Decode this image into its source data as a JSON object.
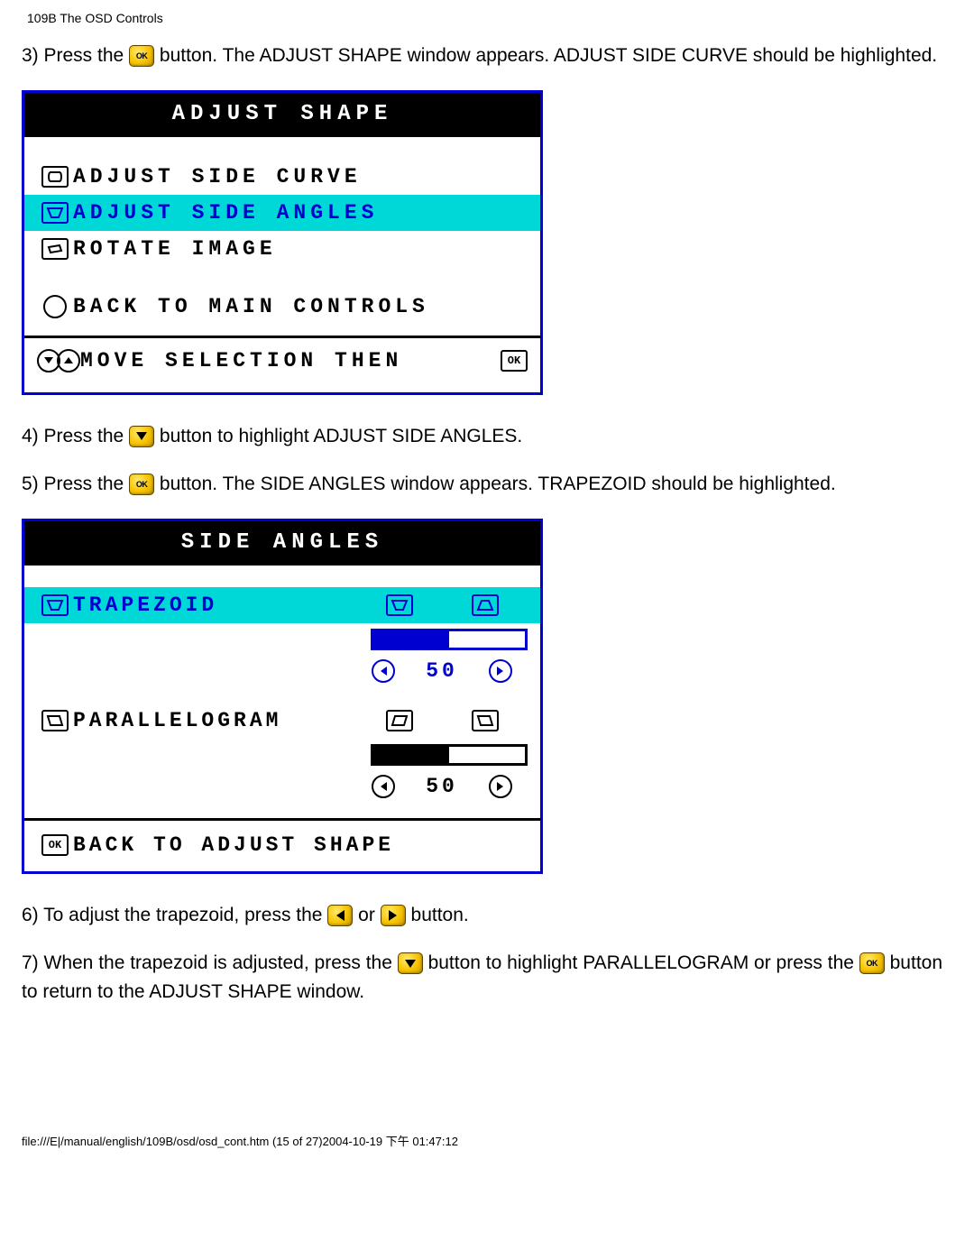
{
  "header": "109B The OSD Controls",
  "step3_a": "3) Press the ",
  "step3_b": " button. The ADJUST SHAPE window appears. ADJUST SIDE CURVE should be highlighted.",
  "osd1": {
    "title": "ADJUST SHAPE",
    "items": [
      "ADJUST SIDE CURVE",
      "ADJUST SIDE ANGLES",
      "ROTATE IMAGE"
    ],
    "back": "BACK TO MAIN CONTROLS",
    "footer": "MOVE SELECTION THEN",
    "ok": "OK"
  },
  "step4_a": "4) Press the ",
  "step4_b": " button to highlight ADJUST SIDE ANGLES.",
  "step5_a": "5) Press the ",
  "step5_b": " button. The SIDE ANGLES window appears. TRAPEZOID should be highlighted.",
  "osd2": {
    "title": "SIDE ANGLES",
    "trapezoid": "TRAPEZOID",
    "value1": "50",
    "parallelogram": "PARALLELOGRAM",
    "value2": "50",
    "back": "BACK TO ADJUST SHAPE",
    "ok": "OK"
  },
  "step6_a": "6) To adjust the trapezoid, press the ",
  "step6_mid": " or ",
  "step6_b": " button.",
  "step7_a": "7) When the trapezoid is adjusted, press the ",
  "step7_b": " button to highlight PARALLELOGRAM or press the ",
  "step7_c": " button to return to the ADJUST SHAPE window.",
  "footer_path": "file:///E|/manual/english/109B/osd/osd_cont.htm (15 of 27)2004-10-19 下午 01:47:12"
}
